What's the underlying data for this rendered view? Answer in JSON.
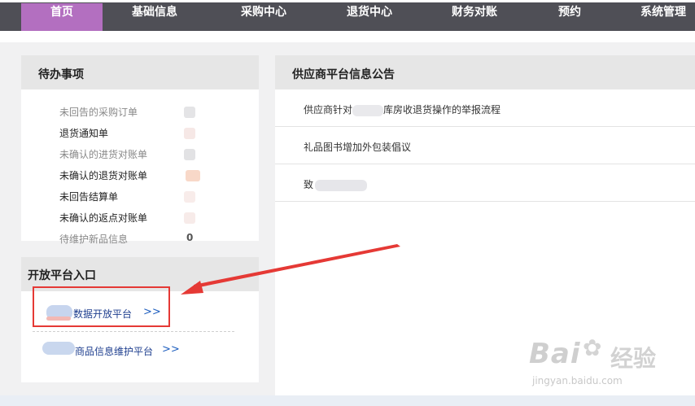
{
  "nav": {
    "items": [
      {
        "label": "首页",
        "active": true
      },
      {
        "label": "基础信息",
        "active": false
      },
      {
        "label": "采购中心",
        "active": false
      },
      {
        "label": "退货中心",
        "active": false
      },
      {
        "label": "财务对账",
        "active": false
      },
      {
        "label": "预约",
        "active": false
      },
      {
        "label": "系统管理",
        "active": false
      }
    ],
    "active_color": "#b36fc0",
    "bar_color": "#4f4f56"
  },
  "todo": {
    "title": "待办事项",
    "items": [
      {
        "label": "未回告的采购订单"
      },
      {
        "label": "退货通知单"
      },
      {
        "label": "未确认的进货对账单"
      },
      {
        "label": "未确认的退货对账单"
      },
      {
        "label": "未回告结算单"
      },
      {
        "label": "未确认的返点对账单"
      },
      {
        "label": "待维护新品信息",
        "count": "0"
      }
    ]
  },
  "portal": {
    "title": "开放平台入口",
    "links": [
      {
        "label": "数据开放平台",
        "chevron": ">>"
      },
      {
        "label": "商品信息维护平台",
        "chevron": ">>"
      }
    ]
  },
  "notices": {
    "title": "供应商平台信息公告",
    "items": [
      {
        "before": "供应商针对",
        "after": "库房收退货操作的举报流程"
      },
      {
        "before": "礼品图书增加外包装倡议",
        "after": ""
      },
      {
        "before": "致",
        "after": ""
      }
    ]
  },
  "watermark": {
    "brand": "Bai",
    "brand_tail": "经验",
    "url": "jingyan.baidu.com"
  },
  "annotation_color": "#e53935"
}
